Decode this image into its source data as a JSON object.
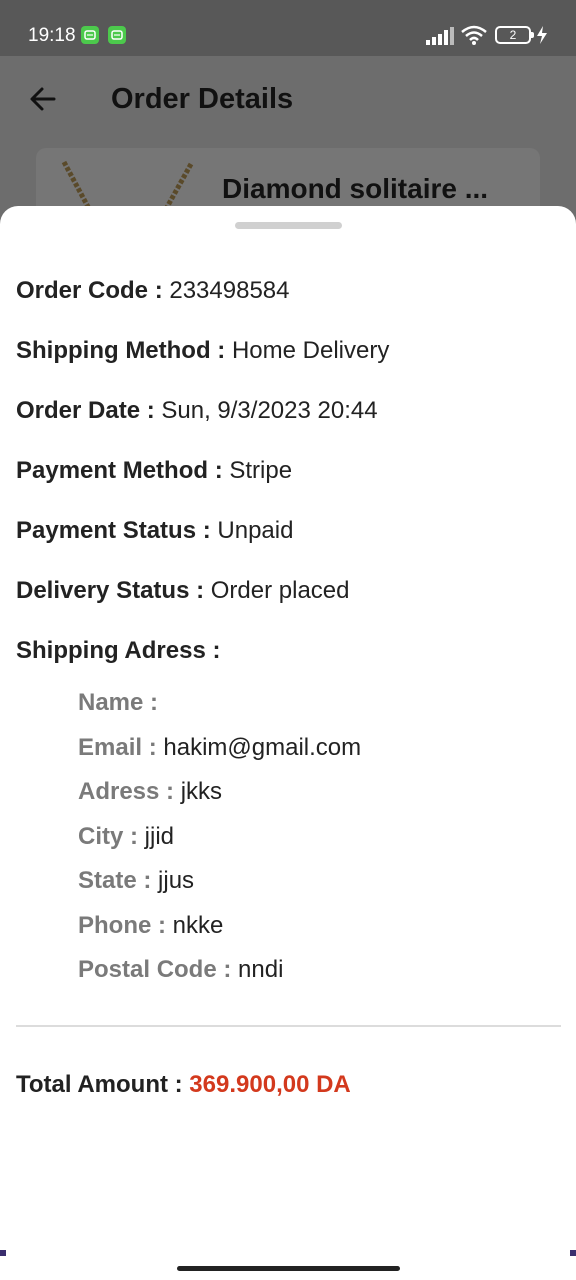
{
  "status_bar": {
    "time": "19:18",
    "battery_level": "2",
    "icons": [
      "notification-app-icon",
      "notification-app-icon",
      "signal-icon",
      "wifi-icon",
      "battery-icon",
      "charging-bolt-icon"
    ]
  },
  "app_bar": {
    "title": "Order Details",
    "back_icon": "back-arrow-icon"
  },
  "product": {
    "name": "Diamond solitaire ..."
  },
  "order": {
    "code_label": "Order Code :",
    "code": " 233498584",
    "shipping_method_label": "Shipping Method :",
    "shipping_method": " Home Delivery",
    "date_label": "Order Date :",
    "date": " Sun, 9/3/2023 20:44",
    "payment_method_label": "Payment Method :",
    "payment_method": " Stripe",
    "payment_status_label": "Payment Status :",
    "payment_status": " Unpaid",
    "delivery_status_label": "Delivery Status :",
    "delivery_status": " Order placed",
    "shipping_address_label": "Shipping  Adress :"
  },
  "address": {
    "name_label": "Name :",
    "name": "",
    "email_label": "Email :",
    "email": " hakim@gmail.com",
    "adress_label": "Adress :",
    "adress": " jkks",
    "city_label": "City :",
    "city": " jjid",
    "state_label": "State :",
    "state": " jjus",
    "phone_label": "Phone :",
    "phone": " nkke",
    "postal_label": "Postal Code :",
    "postal": " nndi"
  },
  "total": {
    "label": "Total Amount :",
    "amount": " 369.900,00 DA",
    "amount_color": "#d3391d"
  }
}
